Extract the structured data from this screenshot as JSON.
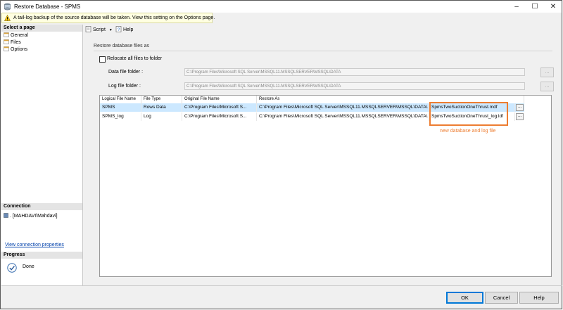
{
  "window": {
    "title": "Restore Database - SPMS"
  },
  "infobar": {
    "text": "A tail-log backup of the source database will be taken. View this setting on the Options page."
  },
  "left_panel": {
    "select_page_header": "Select a page",
    "pages": [
      {
        "label": "General"
      },
      {
        "label": "Files"
      },
      {
        "label": "Options"
      }
    ],
    "connection_header": "Connection",
    "connection_text": ". [MAHDAVI\\Mahdavi]",
    "connection_link": "View connection properties",
    "progress_header": "Progress",
    "progress_status": "Done"
  },
  "toolbar": {
    "script_label": "Script",
    "help_label": "Help"
  },
  "content": {
    "section_label": "Restore database files as",
    "relocate_label": "Relocate all files to folder",
    "data_folder_label": "Data file folder :",
    "data_folder_value": "C:\\Program Files\\Microsoft SQL Server\\MSSQL11.MSSQLSERVER\\MSSQL\\DATA",
    "log_folder_label": "Log file folder :",
    "log_folder_value": "C:\\Program Files\\Microsoft SQL Server\\MSSQL11.MSSQLSERVER\\MSSQL\\DATA",
    "browse_label": "...",
    "relocate_checked": false
  },
  "grid": {
    "columns": [
      "Logical File Name",
      "File Type",
      "Original File Name",
      "Restore As"
    ],
    "rows": [
      {
        "logical": "SPMS",
        "type": "Rows Data",
        "original": "C:\\Program Files\\Microsoft S...",
        "restore_path": "C:\\Program Files\\Microsoft SQL Server\\MSSQL11.MSSQLSERVER\\MSSQL\\DATA\\",
        "restore_file": "SpmsTwoSuctionOneThrust.mdf",
        "btn": "..."
      },
      {
        "logical": "SPMS_log",
        "type": "Log",
        "original": "C:\\Program Files\\Microsoft S...",
        "restore_path": "C:\\Program Files\\Microsoft SQL Server\\MSSQL11.MSSQLSERVER\\MSSQL\\DATA\\",
        "restore_file": "SpmsTwoSuctionOneThrust_log.ldf",
        "btn": "..."
      }
    ]
  },
  "annotation": {
    "text": "new database and log file",
    "color": "#ed7d31"
  },
  "footer": {
    "ok_label": "OK",
    "cancel_label": "Cancel",
    "help_label": "Help"
  }
}
